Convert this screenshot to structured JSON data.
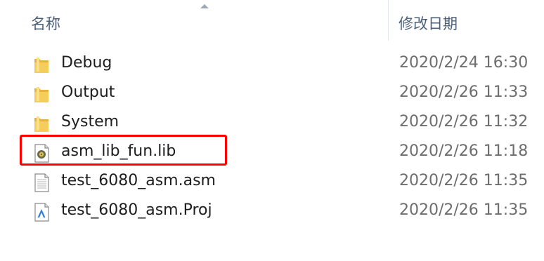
{
  "columns": {
    "name": "名称",
    "date_modified": "修改日期"
  },
  "files": [
    {
      "name": "Debug",
      "date": "2020/2/24 16:30",
      "icon": "folder-icon"
    },
    {
      "name": "Output",
      "date": "2020/2/26 11:33",
      "icon": "folder-icon"
    },
    {
      "name": "System",
      "date": "2020/2/26 11:32",
      "icon": "folder-icon"
    },
    {
      "name": "asm_lib_fun.lib",
      "date": "2020/2/26 11:18",
      "icon": "lib-file-icon"
    },
    {
      "name": "test_6080_asm.asm",
      "date": "2020/2/26 11:35",
      "icon": "text-file-icon"
    },
    {
      "name": "test_6080_asm.Proj",
      "date": "2020/2/26 11:35",
      "icon": "project-file-icon"
    }
  ],
  "highlight_color": "#ff0000",
  "folder_color": "#f3c64b"
}
